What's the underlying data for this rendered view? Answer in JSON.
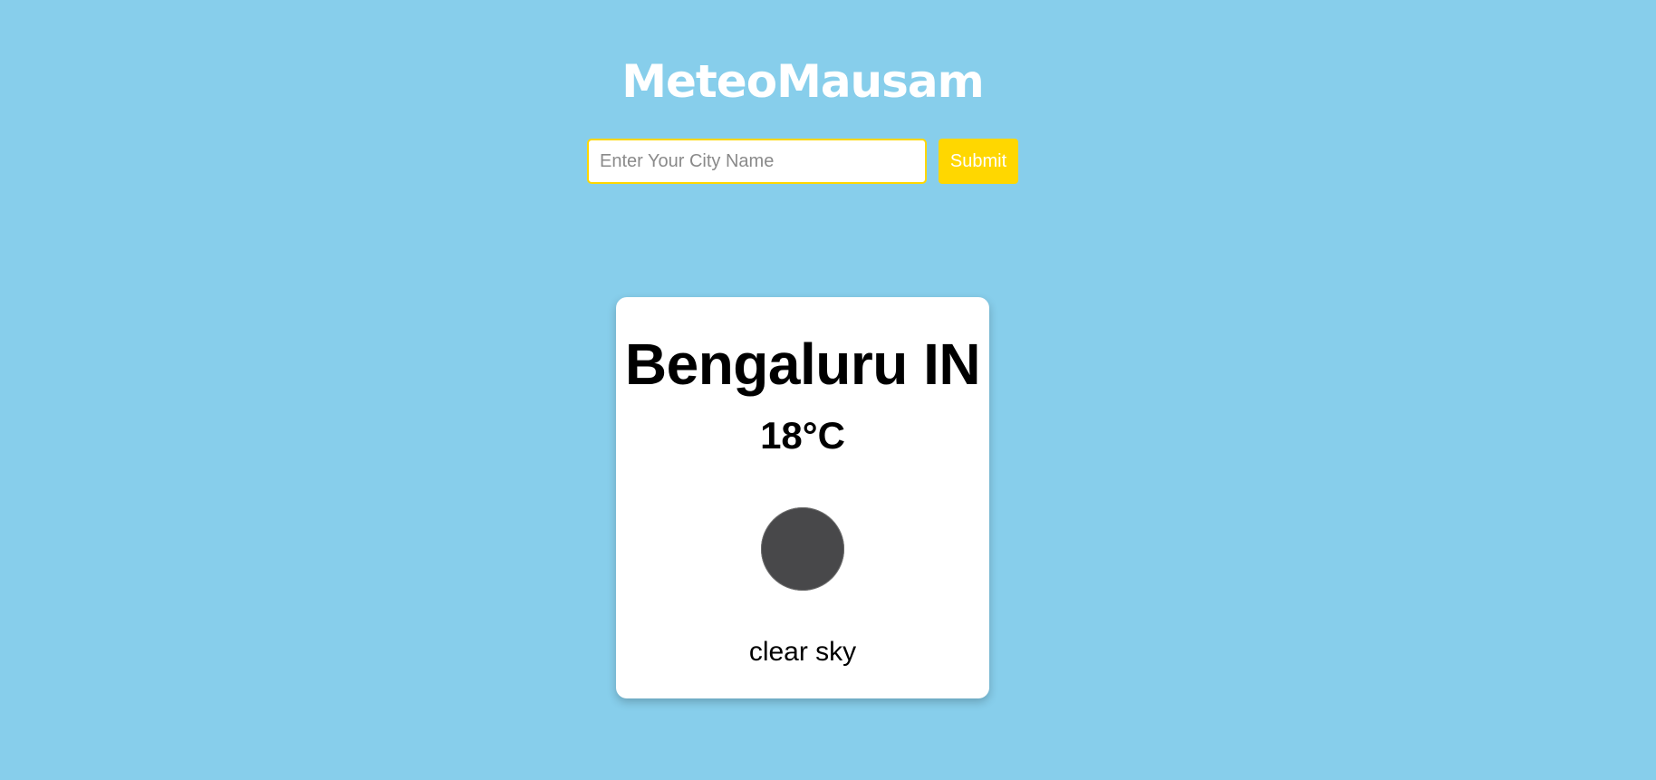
{
  "app": {
    "title": "MeteoMausam"
  },
  "search": {
    "value": "",
    "placeholder": "Enter Your City Name",
    "submit_label": "Submit"
  },
  "weather": {
    "city": "Bengaluru IN",
    "temperature": "18°C",
    "description": "clear sky",
    "icon": "weather-icon"
  },
  "colors": {
    "background": "#87ceeb",
    "accent": "#ffd700",
    "card": "#ffffff",
    "icon": "#48484a"
  }
}
